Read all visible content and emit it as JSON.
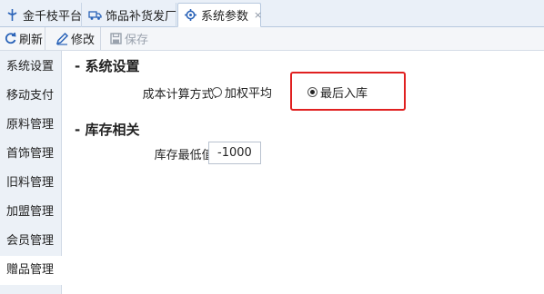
{
  "tabs": [
    {
      "label": "金千枝平台",
      "icon": "platform-icon"
    },
    {
      "label": "饰品补货发厂",
      "icon": "truck-icon"
    },
    {
      "label": "系统参数",
      "icon": "settings-icon",
      "active": true,
      "close": "×"
    }
  ],
  "toolbar": {
    "refresh_label": "刷新",
    "edit_label": "修改",
    "save_label": "保存"
  },
  "sidebar": {
    "items": [
      {
        "label": "系统设置"
      },
      {
        "label": "移动支付"
      },
      {
        "label": "原料管理"
      },
      {
        "label": "首饰管理"
      },
      {
        "label": "旧料管理"
      },
      {
        "label": "加盟管理"
      },
      {
        "label": "会员管理"
      },
      {
        "label": "赠品管理",
        "active": true
      }
    ]
  },
  "main": {
    "system_section_title": "- 系统设置",
    "cost_method_label": "成本计算方式:",
    "cost_options": [
      {
        "label": "加权平均",
        "selected": false
      },
      {
        "label": "最后入库",
        "selected": true
      }
    ],
    "inventory_section_title": "- 库存相关",
    "min_stock_label": "库存最低值:",
    "min_stock_value": "-1000"
  },
  "colors": {
    "accent_blue": "#2a63b8",
    "highlight_red": "#e02020"
  }
}
